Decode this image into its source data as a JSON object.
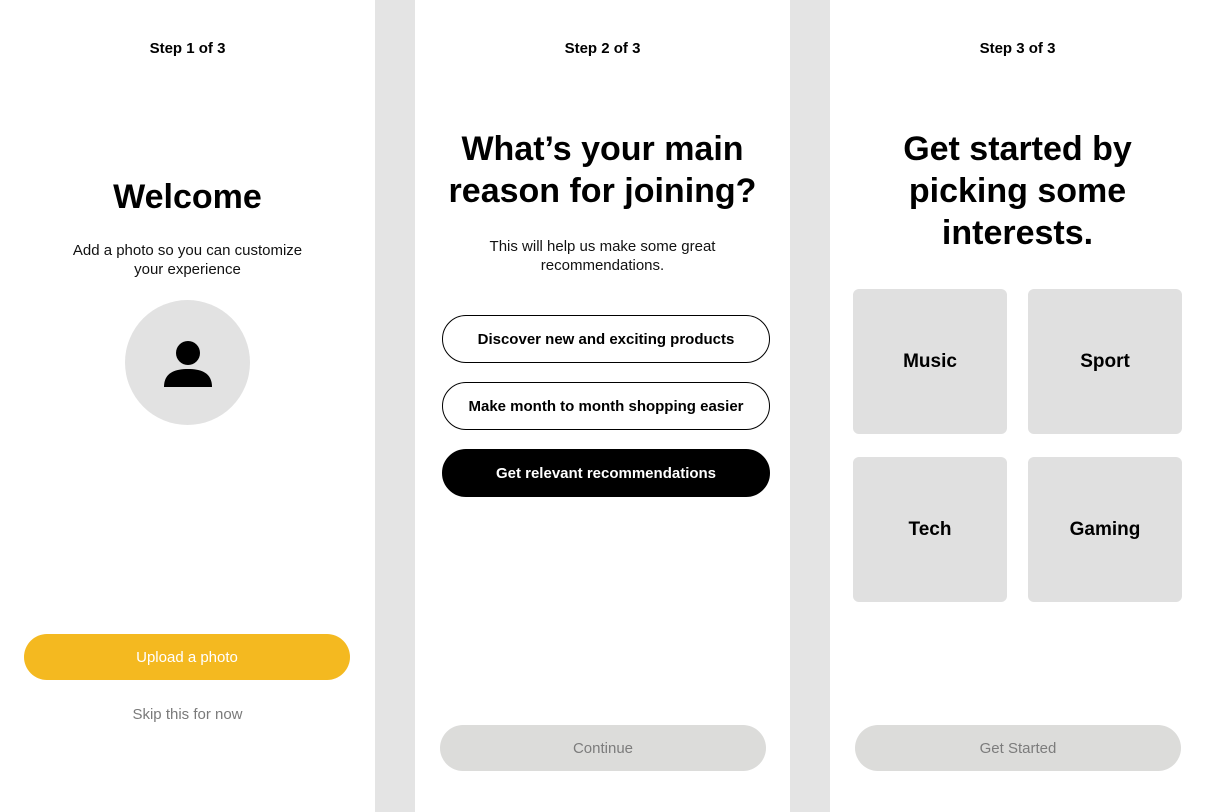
{
  "screen1": {
    "step": "Step 1 of 3",
    "title": "Welcome",
    "subtitle": "Add a photo so you can customize your experience",
    "avatar_icon": "person-icon",
    "upload_label": "Upload a photo",
    "skip_label": "Skip this for now"
  },
  "screen2": {
    "step": "Step 2 of 3",
    "title": "What’s your main reason for joining?",
    "subtitle": "This will help us make some great recommendations.",
    "options": [
      {
        "label": "Discover new and exciting products",
        "selected": false
      },
      {
        "label": "Make month to month shopping easier",
        "selected": false
      },
      {
        "label": "Get relevant recommendations",
        "selected": true
      }
    ],
    "continue_label": "Continue"
  },
  "screen3": {
    "step": "Step 3 of 3",
    "title": "Get started by picking some interests.",
    "interests": [
      "Music",
      "Sport",
      "Tech",
      "Gaming"
    ],
    "get_started_label": "Get Started"
  },
  "colors": {
    "accent": "#f4b920",
    "background": "#e4e4e4",
    "tile": "#e0e0e0",
    "disabled_button": "#dcdcda",
    "selected_option": "#000000"
  }
}
